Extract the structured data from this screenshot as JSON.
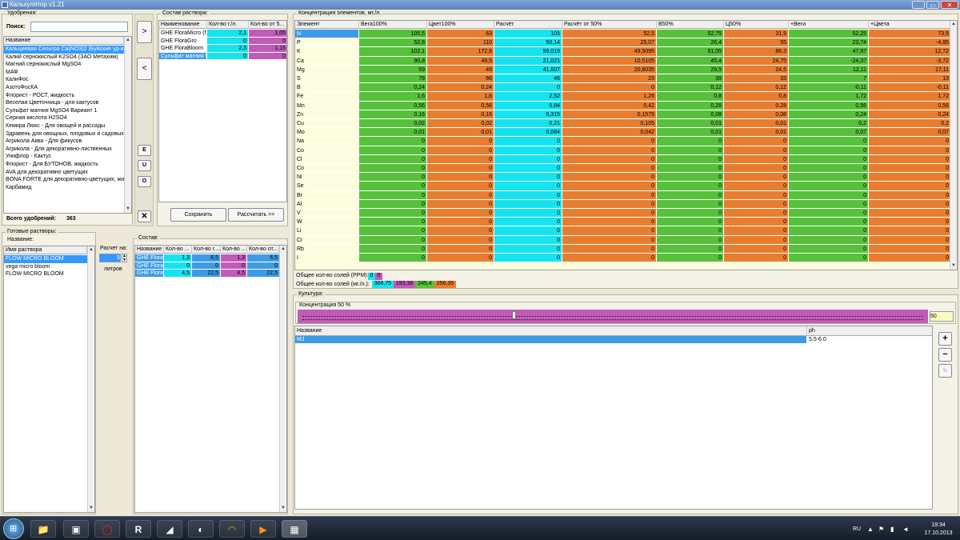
{
  "window": {
    "title": "Калькулятор v1.21",
    "min": "_",
    "max": "▭",
    "close": "✕"
  },
  "fert": {
    "group": "Удобрения:",
    "search_label": "Поиск:",
    "search_value": "",
    "col_name": "Название",
    "items": [
      "Кальциевая Сельтра Ca(NO3)2 (Буйские уд-я)",
      "Калий сернокислый K2SO4 (ЗАО Метахим)",
      "Магний сернокислый MgSO4",
      "МАФ",
      "КалиФос",
      "АзотоФосКА",
      "Флорист - РОСТ, жидкость",
      "Веселая Цветочница - для кактусов",
      "Сульфат магния MgSO4 Вариант 1",
      "Серная кислота H2SO4",
      "Кемира Люкс - Для овощей и рассады",
      "Здравень для овощных, плодовых и садовых к",
      "Агрикола Аква - Для фикусов",
      "Агрикола - Для декоративно-лиственных",
      "Унифлор - Кактус",
      "Флорист - Для БУТОНОВ, жидкость",
      "AVA для декоративно цветущих",
      "BONA FORTE для декоративно-цветущих, жидк",
      "Карбамид"
    ],
    "total_label": "Всего удобрений:",
    "total_value": "363"
  },
  "mid_buttons": {
    "add": ">",
    "remove": "<",
    "e": "E",
    "u": "U",
    "o": "O",
    "x": "✕"
  },
  "comp": {
    "group": "Состав раствора:",
    "headers": [
      "Наименование",
      "Кол-во г./л.",
      "Кол-во от 5..."
    ],
    "rows": [
      [
        "GHE FloraMicro (ha",
        "2,1",
        "1,05"
      ],
      [
        "GHE FloraGro",
        "0",
        "0"
      ],
      [
        "GHE FloraBloom",
        "2,3",
        "1,15"
      ],
      [
        "Сульфат магния M",
        "0",
        "0"
      ]
    ],
    "save": "Сохранить",
    "calc": "Рассчитать >>"
  },
  "conc": {
    "group": "Концентрация элементов, мг./л.",
    "headers": [
      "Элемент",
      "Вега100%",
      "Цвет100%",
      "Расчёт",
      "Расчёт от 50%",
      "В50%",
      "Ц50%",
      "+Веги",
      "+Цвета"
    ],
    "rows": [
      [
        "N",
        "105,5",
        "63",
        "105",
        "52,5",
        "52,75",
        "31,5",
        "52,25",
        "73,5"
      ],
      [
        "P",
        "52,8",
        "110",
        "50,14",
        "25,07",
        "26,4",
        "55",
        "23,74",
        "-4,85"
      ],
      [
        "K",
        "102,1",
        "172,6",
        "99,019",
        "49,5095",
        "51,05",
        "86,3",
        "47,97",
        "12,72"
      ],
      [
        "Ca",
        "90,8",
        "49,5",
        "21,021",
        "10,5105",
        "45,4",
        "24,75",
        "-24,37",
        "-3,72"
      ],
      [
        "Mg",
        "59",
        "49",
        "41,607",
        "20,8035",
        "29,5",
        "24,5",
        "12,11",
        "17,11"
      ],
      [
        "S",
        "78",
        "66",
        "46",
        "23",
        "39",
        "33",
        "7",
        "13"
      ],
      [
        "B",
        "0,24",
        "0,24",
        "0",
        "0",
        "0,12",
        "0,12",
        "-0,11",
        "-0,11"
      ],
      [
        "Fe",
        "1,6",
        "1,6",
        "2,52",
        "1,26",
        "0,8",
        "0,8",
        "1,72",
        "1,72"
      ],
      [
        "Mn",
        "0,56",
        "0,56",
        "0,84",
        "0,42",
        "0,28",
        "0,28",
        "0,56",
        "0,56"
      ],
      [
        "Zn",
        "0,16",
        "0,16",
        "0,315",
        "0,1575",
        "0,08",
        "0,08",
        "0,24",
        "0,24"
      ],
      [
        "Cu",
        "0,02",
        "0,02",
        "0,21",
        "0,105",
        "0,01",
        "0,01",
        "0,2",
        "0,2"
      ],
      [
        "Mo",
        "0,01",
        "0,01",
        "0,084",
        "0,042",
        "0,01",
        "0,01",
        "0,07",
        "0,07"
      ],
      [
        "Na",
        "0",
        "0",
        "0",
        "0",
        "0",
        "0",
        "0",
        "0"
      ],
      [
        "Co",
        "0",
        "0",
        "0",
        "0",
        "0",
        "0",
        "0",
        "0"
      ],
      [
        "Cl",
        "0",
        "0",
        "0",
        "0",
        "0",
        "0",
        "0",
        "0"
      ],
      [
        "Co",
        "0",
        "0",
        "0",
        "0",
        "0",
        "0",
        "0",
        "0"
      ],
      [
        "Ni",
        "0",
        "0",
        "0",
        "0",
        "0",
        "0",
        "0",
        "0"
      ],
      [
        "Se",
        "0",
        "0",
        "0",
        "0",
        "0",
        "0",
        "0",
        "0"
      ],
      [
        "Br",
        "0",
        "0",
        "0",
        "0",
        "0",
        "0",
        "0",
        "0"
      ],
      [
        "Al",
        "0",
        "0",
        "0",
        "0",
        "0",
        "0",
        "0",
        "0"
      ],
      [
        "V",
        "0",
        "0",
        "0",
        "0",
        "0",
        "0",
        "0",
        "0"
      ],
      [
        "W",
        "0",
        "0",
        "0",
        "0",
        "0",
        "0",
        "0",
        "0"
      ],
      [
        "Li",
        "0",
        "0",
        "0",
        "0",
        "0",
        "0",
        "0",
        "0"
      ],
      [
        "Cr",
        "0",
        "0",
        "0",
        "0",
        "0",
        "0",
        "0",
        "0"
      ],
      [
        "Rb",
        "0",
        "0",
        "0",
        "0",
        "0",
        "0",
        "0",
        "0"
      ],
      [
        "I",
        "0",
        "0",
        "0",
        "0",
        "0",
        "0",
        "0",
        "0"
      ]
    ],
    "ppm_label": "Общее кол-во солей (PPM):",
    "ppm_values": [
      "0",
      "0"
    ],
    "mg_label": "Общее кол-во солей (мг./л.):",
    "mg_values": [
      "366,75",
      "193,38",
      "245,4",
      "256,35"
    ]
  },
  "ready": {
    "group": "Готовые растворы:",
    "sub": "Название:",
    "col": "Имя раствора",
    "items": [
      "FLOW MICRO BLOOM",
      "vega micro bloom",
      "FLOW MICRO BLOOM"
    ],
    "calc_label": "Расчет на:",
    "calc_value": "5",
    "liters": "литров"
  },
  "sostav": {
    "group": "Состав:",
    "headers": [
      "Название",
      "Кол-во ...",
      "Кол-во г....",
      "Кол-во ...",
      "Кол-во от..."
    ],
    "rows": [
      [
        "GHE Floral",
        "1,3",
        "6,5",
        "1,3",
        "6,5"
      ],
      [
        "GHE Floral",
        "0",
        "0",
        "0",
        "0"
      ],
      [
        "GHE Floral",
        "4,5",
        "22,5",
        "4,5",
        "22,5"
      ]
    ]
  },
  "culture": {
    "group": "Культура:",
    "conc_label": "Концентрация 50 %",
    "slider_value": "50",
    "col_name": "Название",
    "col_ph": "ph",
    "rows": [
      [
        "MJ",
        "5.5-6.0"
      ]
    ],
    "plus": "+",
    "minus": "−",
    "edit": "✎"
  },
  "taskbar": {
    "lang": "RU",
    "time": "19:34",
    "date": "17.10.2013"
  },
  "colors": {
    "green": "#56c13a",
    "orange": "#e97d2f",
    "cyan": "#16e3f0",
    "magenta": "#c25ab8",
    "blue": "#3e9be6",
    "yellow": "#fdfcdd"
  }
}
